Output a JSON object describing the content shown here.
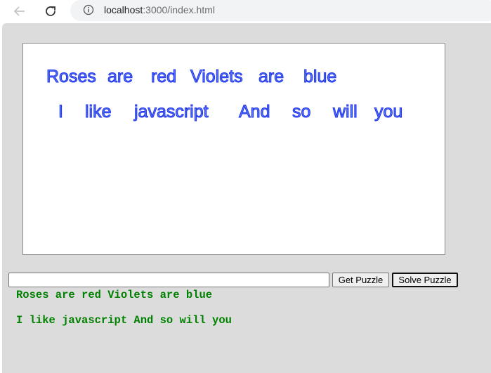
{
  "browser": {
    "url_host": "localhost",
    "url_path": ":3000/index.html",
    "back_icon": "arrow-left-icon",
    "reload_icon": "reload-icon",
    "info_icon": "info-icon"
  },
  "puzzle": {
    "line1": [
      "Roses",
      "are",
      "red",
      "Violets",
      "are",
      "blue"
    ],
    "line2": [
      "I",
      "like",
      "javascript",
      "And",
      "so",
      "will",
      "you"
    ],
    "text_color": "#5577ee",
    "outline_color": "#2233ee"
  },
  "controls": {
    "input_value": "",
    "get_button": "Get Puzzle",
    "solve_button": "Solve Puzzle"
  },
  "solution": {
    "line1": "Roses are red Violets are blue",
    "line2": "I like javascript And so will you",
    "color": "#008000"
  }
}
